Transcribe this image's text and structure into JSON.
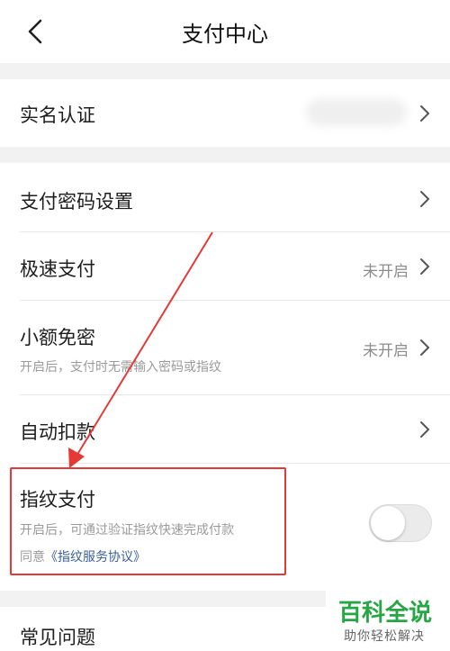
{
  "header": {
    "title": "支付中心"
  },
  "rows": {
    "real_name": {
      "label": "实名认证"
    },
    "pay_password": {
      "label": "支付密码设置"
    },
    "quick_pay": {
      "label": "极速支付",
      "status": "未开启"
    },
    "small_no_pwd": {
      "label": "小额免密",
      "status": "未开启",
      "description": "开启后，支付时无需输入密码或指纹"
    },
    "auto_deduct": {
      "label": "自动扣款"
    },
    "fingerprint_pay": {
      "label": "指纹支付",
      "description": "开启后，可通过验证指纹快速完成付款",
      "agreement_prefix": "同意",
      "agreement_link": "《指纹服务协议》",
      "toggle_on": false
    },
    "faq": {
      "label": "常见问题"
    }
  },
  "annotation": {
    "color": "#e53935"
  },
  "watermark": {
    "title": "百科全说",
    "subtitle": "助你轻松解决",
    "color": "#27a644"
  }
}
